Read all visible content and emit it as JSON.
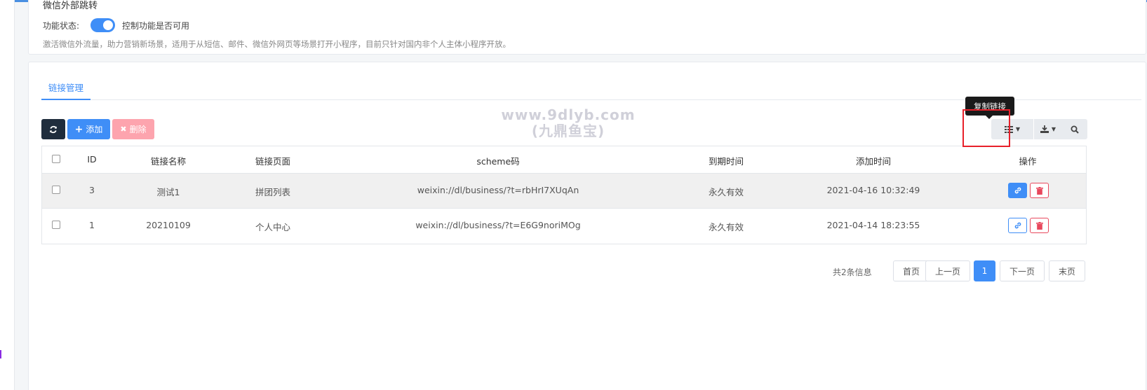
{
  "feature_card": {
    "title": "微信外部跳转",
    "status_label": "功能状态:",
    "status_desc": "控制功能是否可用",
    "note": "激活微信外流量，助力营销新场景，适用于从短信、邮件、微信外网页等场景打开小程序，目前只针对国内非个人主体小程序开放。",
    "enabled": true
  },
  "tabs": [
    {
      "label": "链接管理",
      "active": true
    }
  ],
  "toolbar": {
    "add_label": "添加",
    "delete_label": "删除",
    "refresh_icon": "refresh-icon",
    "columns_icon": "list-icon",
    "export_icon": "download-icon",
    "search_icon": "search-icon"
  },
  "table": {
    "headers": [
      "ID",
      "链接名称",
      "链接页面",
      "scheme码",
      "到期时间",
      "添加时间",
      "操作"
    ],
    "rows": [
      {
        "id": "3",
        "name": "测试1",
        "page": "拼团列表",
        "scheme": "weixin://dl/business/?t=rbHrI7XUqAn",
        "expire": "永久有效",
        "added": "2021-04-16 10:32:49"
      },
      {
        "id": "1",
        "name": "20210109",
        "page": "个人中心",
        "scheme": "weixin://dl/business/?t=E6G9noriMOg",
        "expire": "永久有效",
        "added": "2021-04-14 18:23:55"
      }
    ]
  },
  "tooltip": "复制链接",
  "watermark": [
    "www.9dlyb.com",
    "(九鼎鱼宝)"
  ],
  "pagination": {
    "total": "共2条信息",
    "first": "首页",
    "prev": "上一页",
    "current": "1",
    "next": "下一页",
    "last": "末页"
  },
  "colors": {
    "accent": "#3f8ef7",
    "danger": "#e8485d",
    "dark": "#1f2d3d"
  }
}
